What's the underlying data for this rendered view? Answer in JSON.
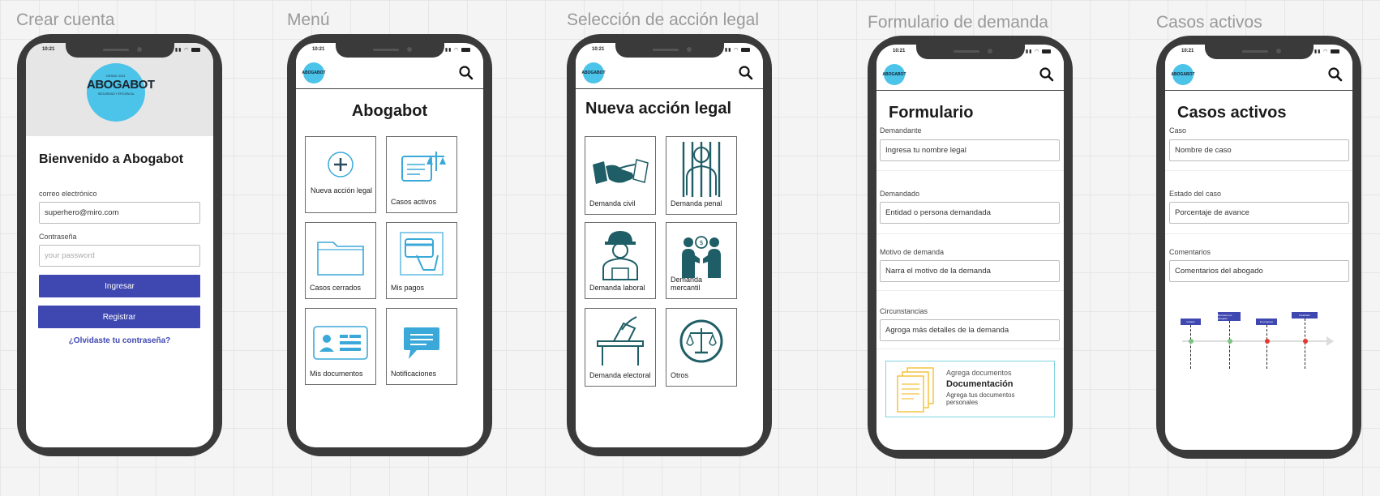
{
  "frames": {
    "crear": {
      "title": "Crear cuenta"
    },
    "menu": {
      "title": "Menú"
    },
    "seleccion": {
      "title": "Selección de acción legal"
    },
    "formulario": {
      "title": "Formulario de demanda"
    },
    "casos": {
      "title": "Casos activos"
    }
  },
  "status_bar": {
    "time": "10:21"
  },
  "logo": {
    "text": "ABOGABOT",
    "tagline": "SEGURIDAD Y EFICIENCIA",
    "year": "DESDE 2021",
    "small": "ABOGABOT"
  },
  "login": {
    "welcome": "Bienvenido a Abogabot",
    "email_label": "correo electrónico",
    "email_value": "superhero@miro.com",
    "password_label": "Contraseña",
    "password_placeholder": "your password",
    "login_button": "Ingresar",
    "register_button": "Registrar",
    "forgot_link": "¿Olvidaste tu contraseña?"
  },
  "menu": {
    "title": "Abogabot",
    "items": [
      {
        "label": "Nueva acción legal",
        "icon": "plus-circle-icon"
      },
      {
        "label": "Casos activos",
        "icon": "scale-document-icon"
      },
      {
        "label": "Casos cerrados",
        "icon": "folder-icon"
      },
      {
        "label": "Mis pagos",
        "icon": "card-payment-icon"
      },
      {
        "label": "Mis documentos",
        "icon": "id-card-icon"
      },
      {
        "label": "Notificaciones",
        "icon": "chat-bubble-icon"
      }
    ]
  },
  "seleccion": {
    "title": "Nueva acción legal",
    "items": [
      {
        "label": "Demanda civil",
        "icon": "handshake-icon"
      },
      {
        "label": "Demanda penal",
        "icon": "prisoner-icon"
      },
      {
        "label": "Demanda laboral",
        "icon": "worker-icon"
      },
      {
        "label": "Demanda mercantil",
        "icon": "money-exchange-icon"
      },
      {
        "label": "Demanda electoral",
        "icon": "ballot-box-icon"
      },
      {
        "label": "Otros",
        "icon": "scale-circle-icon"
      }
    ]
  },
  "formulario": {
    "title": "Formulario",
    "fields": [
      {
        "label": "Demandante",
        "placeholder": "Ingresa tu nombre legal"
      },
      {
        "label": "Demandado",
        "placeholder": "Entidad o persona demandada"
      },
      {
        "label": "Motivo de demanda",
        "placeholder": "Narra el motivo de la demanda"
      },
      {
        "label": "Circunstancias",
        "placeholder": "Agroga más detalles de la demanda"
      }
    ],
    "upload": {
      "hint": "Agrega documentos",
      "title": "Documentación",
      "desc": "Agrega tus documentos personales"
    }
  },
  "casos": {
    "title": "Casos activos",
    "fields": [
      {
        "label": "Caso",
        "placeholder": "Nombre de caso"
      },
      {
        "label": "Estado del caso",
        "placeholder": "Porcentaje de avance"
      },
      {
        "label": "Comentarios",
        "placeholder": "Comentarios del abogado"
      }
    ],
    "timeline": [
      "Iniciado",
      "Revisado por abogado",
      "En progreso",
      "Finalizado"
    ],
    "timeline_colors": [
      "#7bc47f",
      "#7bc47f",
      "#e53935",
      "#e53935"
    ]
  },
  "colors": {
    "primary": "#3f48b0",
    "accent": "#4cc3e8",
    "teal": "#1f5e66",
    "icon_blue": "#3aa9d9"
  }
}
